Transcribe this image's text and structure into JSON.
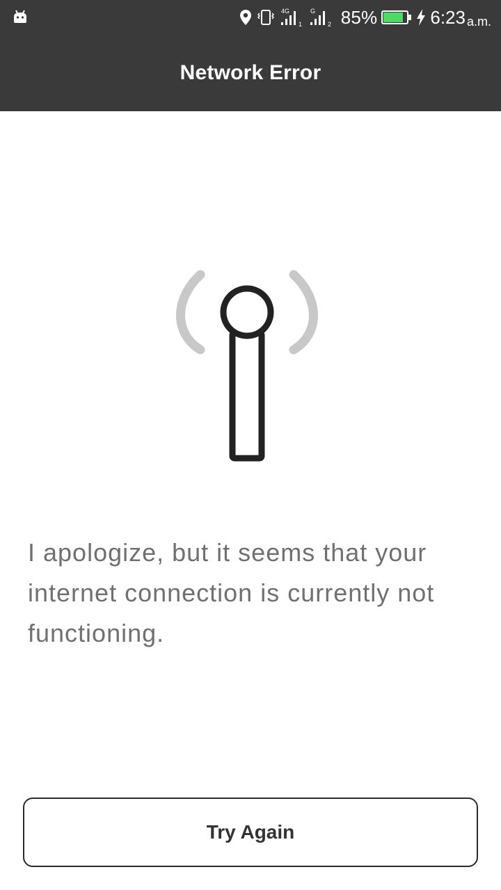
{
  "status_bar": {
    "network_4g_label": "4G",
    "network_g_label": "G",
    "sim1_label": "1",
    "sim2_label": "2",
    "battery_percent": "85%",
    "battery_level": 0.85,
    "time": "6:23",
    "ampm": "a.m.",
    "icons": [
      "android-icon",
      "location-icon",
      "vibrate-icon",
      "signal-icon",
      "signal-icon",
      "battery-icon",
      "charging-icon"
    ]
  },
  "app_bar": {
    "title": "Network Error"
  },
  "main": {
    "illustration": "antenna-signal-icon",
    "message": "I apologize, but it seems that your internet connection is currently not functioning."
  },
  "actions": {
    "try_again_label": "Try Again"
  },
  "colors": {
    "bar_background": "#3a3a3a",
    "message_text": "#707070",
    "wave_gray": "#c8c8c8",
    "antenna_dark": "#222222",
    "battery_green": "#4cd964"
  }
}
